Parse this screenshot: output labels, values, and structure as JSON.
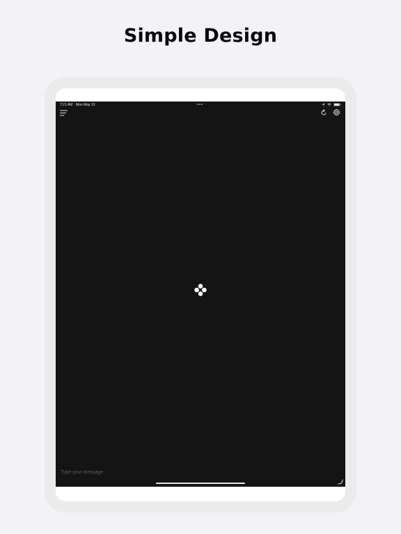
{
  "headline": "Simple Design",
  "status_bar": {
    "time": "7:21 AM",
    "date": "Mon May 13"
  },
  "composer": {
    "placeholder": "Type your message"
  },
  "icons": {
    "menu": "menu-icon",
    "refresh": "refresh-icon",
    "settings": "gear-icon",
    "logo": "four-dot-logo-icon",
    "send": "resize-handle-icon",
    "location": "location-arrow-icon",
    "wifi": "wifi-icon",
    "battery": "battery-icon"
  },
  "colors": {
    "page_background": "#f2f2f7",
    "screen_background": "#141414",
    "icon_color": "#e6e6e6"
  }
}
